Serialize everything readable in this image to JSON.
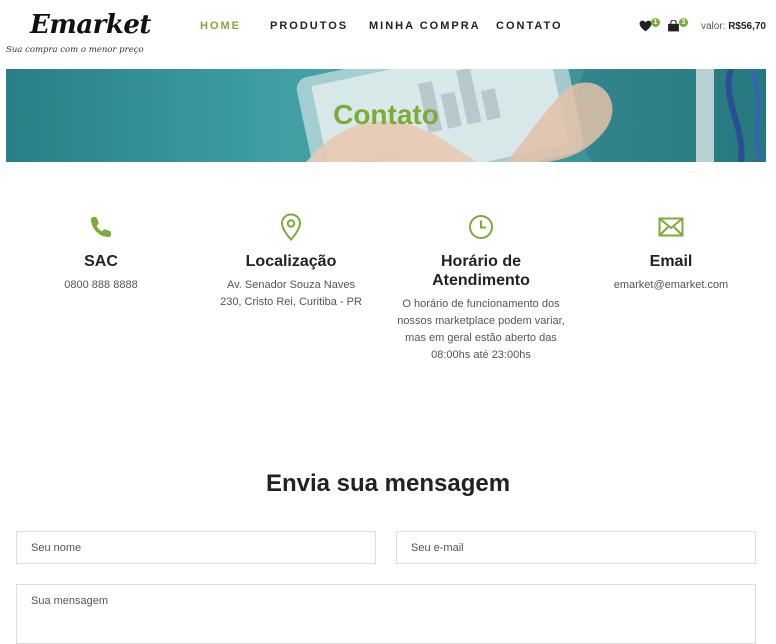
{
  "header": {
    "logo_title": "Emarket",
    "logo_tagline": "Sua compra com o menor preço",
    "nav": [
      {
        "label": "HOME",
        "active": true
      },
      {
        "label": "PRODUTOS",
        "active": false
      },
      {
        "label": "MINHA COMPRA",
        "active": false
      },
      {
        "label": "CONTATO",
        "active": false
      }
    ],
    "wishlist_count": "1",
    "cart_count": "3",
    "valor_label": "valor:",
    "valor_amount": "R$56,70"
  },
  "banner": {
    "title": "Contato"
  },
  "info_cards": [
    {
      "icon": "phone-icon",
      "title": "SAC",
      "text": "0800 888 8888"
    },
    {
      "icon": "location-pin-icon",
      "title": "Localização",
      "text": "Av. Senador Souza Naves 230, Cristo Rei, Curitiba - PR"
    },
    {
      "icon": "clock-icon",
      "title": "Horário de Atendimento",
      "text": "O horário de funcionamento dos nossos marketplace podem variar, mas em geral estão aberto das 08:00hs até 23:00hs"
    },
    {
      "icon": "envelope-icon",
      "title": "Email",
      "text": "emarket@emarket.com"
    }
  ],
  "form": {
    "title": "Envia sua mensagem",
    "name_placeholder": "Seu nome",
    "email_placeholder": "Seu e-mail",
    "message_placeholder": "Sua mensagem"
  },
  "colors": {
    "accent": "#7cab3a",
    "banner": "#3b9aa0"
  }
}
